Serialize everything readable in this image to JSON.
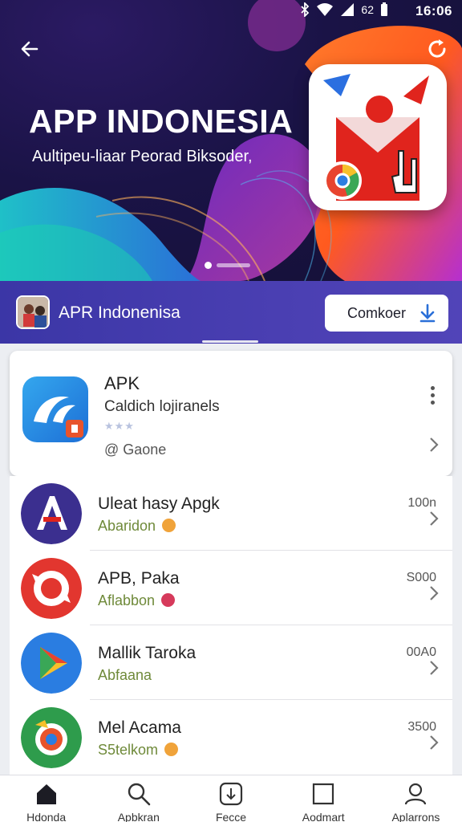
{
  "status_bar": {
    "time": "16:06",
    "battery": "62"
  },
  "hero": {
    "title": "APP INDONESIA",
    "subtitle": "Aultipeu-liaar Peorad Biksoder,"
  },
  "developer": {
    "name": "APR Indonenisa",
    "button_label": "Comkoer"
  },
  "featured": {
    "title": "APK",
    "description": "Caldich lojiranels",
    "stars": "★★★",
    "developer": "@ Gaone"
  },
  "apps": [
    {
      "name": "Uleat hasy Apgk",
      "developer": "Abaridon",
      "size": "100n",
      "accent": "#3b2f8f",
      "badge_color": "#f0a33a"
    },
    {
      "name": "APB, Paka",
      "developer": "Aflabbon",
      "size": "S000",
      "accent": "#e2362f",
      "badge_color": "#d63a5b"
    },
    {
      "name": "Mallik Taroka",
      "developer": "Abfaana",
      "size": "00A0",
      "accent": "#2a7de1",
      "badge_color": "#ffffff"
    },
    {
      "name": "Mel Acama",
      "developer": "S5telkom",
      "size": "3500",
      "accent": "#2e9c4c",
      "badge_color": "#f0a33a"
    }
  ],
  "bottom_nav": [
    {
      "label": "Hdonda",
      "icon": "home-icon"
    },
    {
      "label": "Apbkran",
      "icon": "search-icon"
    },
    {
      "label": "Fecce",
      "icon": "apps-icon"
    },
    {
      "label": "Aodmart",
      "icon": "square-icon"
    },
    {
      "label": "Aplarrons",
      "icon": "profile-icon"
    }
  ],
  "colors": {
    "strip": "#4a3fb2",
    "accent_orange": "#ff6a2a",
    "accent_red": "#e0241d"
  }
}
